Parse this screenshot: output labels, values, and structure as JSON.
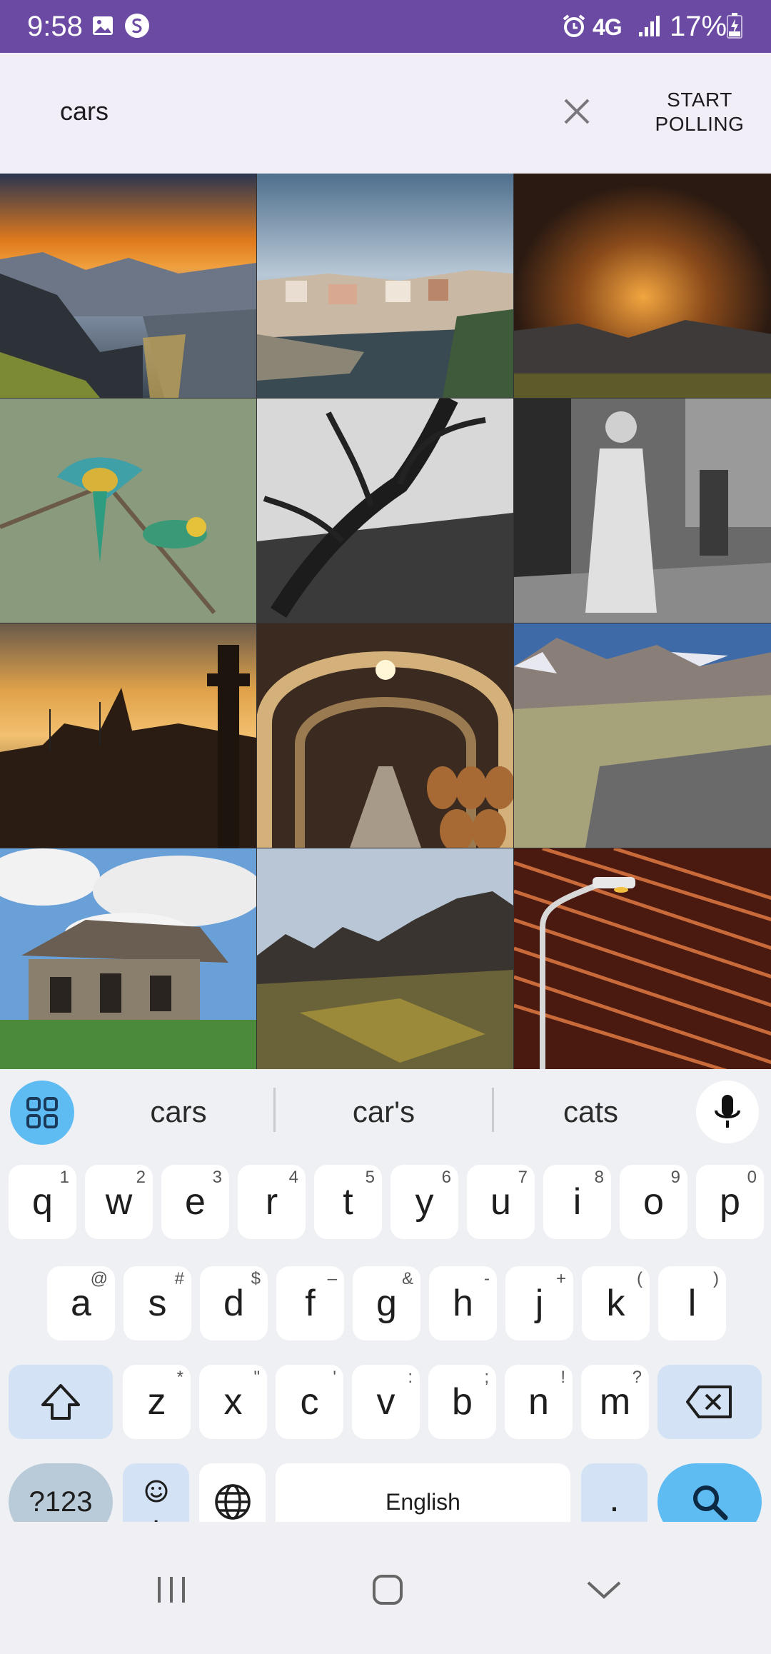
{
  "status_bar": {
    "time": "9:58",
    "network": "4G",
    "battery": "17%",
    "icons": [
      "gallery-icon",
      "sync-app-icon",
      "alarm-icon",
      "network-4g-icon",
      "signal-icon",
      "battery-charging-icon"
    ]
  },
  "search": {
    "query": "cars",
    "clear_icon": "close-icon",
    "poll_button": "START\nPOLLING"
  },
  "grid": {
    "columns": 3,
    "tiles": [
      {
        "id": "sunset-mountain-lake"
      },
      {
        "id": "coastal-town"
      },
      {
        "id": "storm-clouds"
      },
      {
        "id": "bee-eater-birds"
      },
      {
        "id": "bw-tree"
      },
      {
        "id": "bw-woman-street"
      },
      {
        "id": "village-sunset-windmills"
      },
      {
        "id": "wine-cellar-barrels"
      },
      {
        "id": "rocky-valley"
      },
      {
        "id": "abandoned-house"
      },
      {
        "id": "rocky-field"
      },
      {
        "id": "street-lamp-facade"
      }
    ]
  },
  "keyboard": {
    "suggestions": [
      "cars",
      "car's",
      "cats"
    ],
    "row1": [
      {
        "k": "q",
        "h": "1"
      },
      {
        "k": "w",
        "h": "2"
      },
      {
        "k": "e",
        "h": "3"
      },
      {
        "k": "r",
        "h": "4"
      },
      {
        "k": "t",
        "h": "5"
      },
      {
        "k": "y",
        "h": "6"
      },
      {
        "k": "u",
        "h": "7"
      },
      {
        "k": "i",
        "h": "8"
      },
      {
        "k": "o",
        "h": "9"
      },
      {
        "k": "p",
        "h": "0"
      }
    ],
    "row2": [
      {
        "k": "a",
        "h": "@"
      },
      {
        "k": "s",
        "h": "#"
      },
      {
        "k": "d",
        "h": "$"
      },
      {
        "k": "f",
        "h": "–"
      },
      {
        "k": "g",
        "h": "&"
      },
      {
        "k": "h",
        "h": "-"
      },
      {
        "k": "j",
        "h": "+"
      },
      {
        "k": "k",
        "h": "("
      },
      {
        "k": "l",
        "h": ")"
      }
    ],
    "row3": [
      {
        "k": "z",
        "h": "*"
      },
      {
        "k": "x",
        "h": "\""
      },
      {
        "k": "c",
        "h": "'"
      },
      {
        "k": "v",
        "h": ":"
      },
      {
        "k": "b",
        "h": ";"
      },
      {
        "k": "n",
        "h": "!"
      },
      {
        "k": "m",
        "h": "?"
      }
    ],
    "symbols_key": "?123",
    "emoji_key": "☺\n,",
    "space_label": "English",
    "period_key": ".",
    "colors": {
      "accent": "#5fbcf3",
      "special_key": "#d3e3f5",
      "status_bar": "#6a4aa2"
    }
  },
  "nav_bar": {
    "icons": [
      "recents-icon",
      "home-icon",
      "back-chevron-icon"
    ]
  }
}
